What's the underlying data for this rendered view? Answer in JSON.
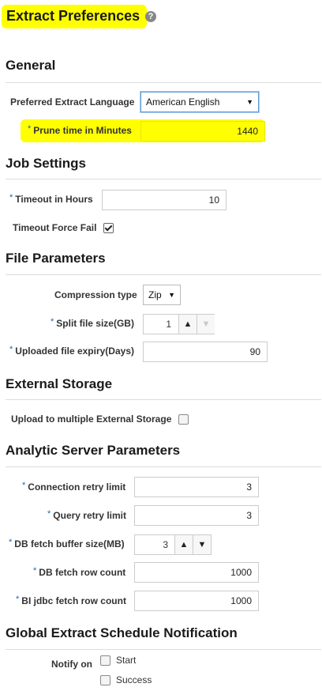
{
  "page": {
    "title": "Extract Preferences",
    "help_icon": "?"
  },
  "colors": {
    "highlight": "#ffff00",
    "required": "#1e66b4",
    "rule": "#dcdcdc"
  },
  "general": {
    "heading": "General",
    "language_label": "Preferred Extract Language",
    "language_value": "American English",
    "prune_label": "Prune time in Minutes",
    "prune_value": "1440"
  },
  "job": {
    "heading": "Job Settings",
    "timeout_label": "Timeout in Hours",
    "timeout_value": "10",
    "force_fail_label": "Timeout Force Fail",
    "force_fail_checked": true
  },
  "file": {
    "heading": "File Parameters",
    "compression_label": "Compression type",
    "compression_value": "Zip",
    "split_label": "Split file size(GB)",
    "split_value": "1",
    "expiry_label": "Uploaded file expiry(Days)",
    "expiry_value": "90"
  },
  "storage": {
    "heading": "External Storage",
    "multi_label": "Upload to multiple External Storage",
    "multi_checked": false
  },
  "analytic": {
    "heading": "Analytic Server Parameters",
    "conn_label": "Connection retry limit",
    "conn_value": "3",
    "query_label": "Query retry limit",
    "query_value": "3",
    "buffer_label": "DB fetch buffer size(MB)",
    "buffer_value": "3",
    "rowcount_label": "DB fetch row count",
    "rowcount_value": "1000",
    "bi_label": "BI jdbc fetch row count",
    "bi_value": "1000"
  },
  "notification": {
    "heading": "Global Extract Schedule Notification",
    "notify_label": "Notify on",
    "options": [
      "Start",
      "Success"
    ]
  },
  "required_mark": "*"
}
